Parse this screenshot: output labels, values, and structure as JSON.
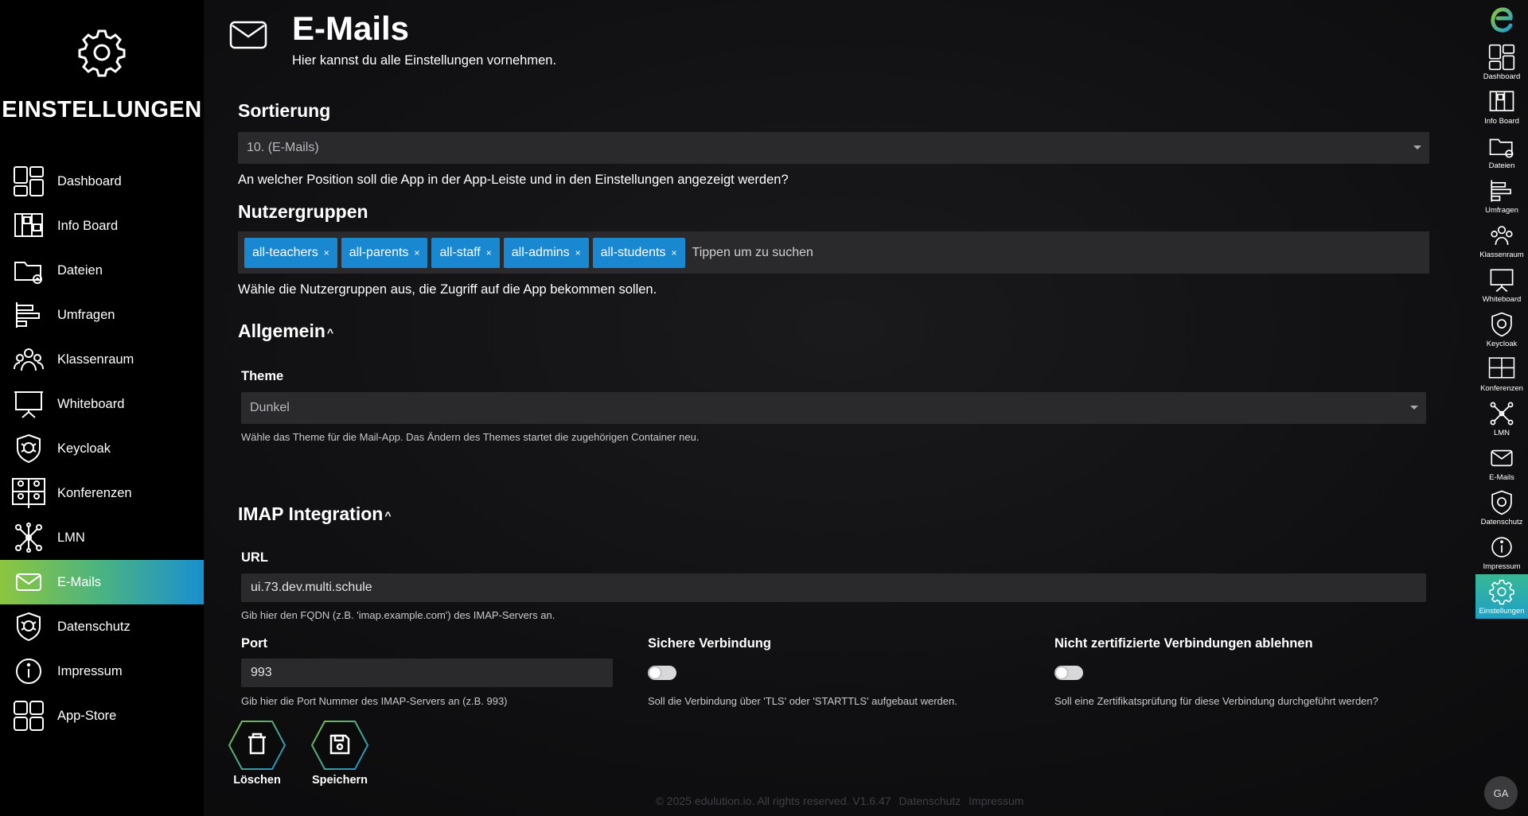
{
  "sidebar": {
    "title": "EINSTELLUNGEN",
    "items": [
      {
        "label": "Dashboard",
        "icon": "dashboard-icon"
      },
      {
        "label": "Info Board",
        "icon": "info-board-icon"
      },
      {
        "label": "Dateien",
        "icon": "files-icon"
      },
      {
        "label": "Umfragen",
        "icon": "surveys-icon"
      },
      {
        "label": "Klassenraum",
        "icon": "classroom-icon"
      },
      {
        "label": "Whiteboard",
        "icon": "whiteboard-icon"
      },
      {
        "label": "Keycloak",
        "icon": "keycloak-icon"
      },
      {
        "label": "Konferenzen",
        "icon": "conferences-icon"
      },
      {
        "label": "LMN",
        "icon": "network-icon"
      },
      {
        "label": "E-Mails",
        "icon": "mail-icon",
        "active": true
      },
      {
        "label": "Datenschutz",
        "icon": "privacy-icon"
      },
      {
        "label": "Impressum",
        "icon": "info-icon"
      },
      {
        "label": "App-Store",
        "icon": "app-store-icon"
      }
    ]
  },
  "rightbar": {
    "logo": "edulution-logo",
    "items": [
      "Dashboard",
      "Info Board",
      "Dateien",
      "Umfragen",
      "Klassenraum",
      "Whiteboard",
      "Keycloak",
      "Konferenzen",
      "LMN",
      "E-Mails",
      "Datenschutz",
      "Impressum",
      "Einstellungen"
    ],
    "avatar": "GA"
  },
  "page": {
    "title": "E-Mails",
    "subtitle": "Hier kannst du alle Einstellungen vornehmen."
  },
  "sorting": {
    "heading": "Sortierung",
    "value": "10. (E-Mails)",
    "help": "An welcher Position soll die App in der App-Leiste und in den Einstellungen angezeigt werden?"
  },
  "groups": {
    "heading": "Nutzergruppen",
    "tags": [
      "all-teachers",
      "all-parents",
      "all-staff",
      "all-admins",
      "all-students"
    ],
    "remove_glyph": "×",
    "placeholder": "Tippen um zu suchen",
    "help": "Wähle die Nutzergruppen aus, die Zugriff auf die App bekommen sollen."
  },
  "general": {
    "heading": "Allgemein",
    "chevron": "^",
    "theme_label": "Theme",
    "theme_value": "Dunkel",
    "theme_help": "Wähle das Theme für die Mail-App. Das Ändern des Themes startet die zugehörigen Container neu."
  },
  "imap": {
    "heading": "IMAP Integration",
    "chevron": "^",
    "url_label": "URL",
    "url_value": "ui.73.dev.multi.schule",
    "url_help": "Gib hier den FQDN (z.B. 'imap.example.com') des IMAP-Servers an.",
    "port_label": "Port",
    "port_value": "993",
    "port_help": "Gib hier die Port Nummer des IMAP-Servers an (z.B. 993)",
    "secure_label": "Sichere Verbindung",
    "secure_help": "Soll die Verbindung über 'TLS' oder 'STARTTLS' aufgebaut werden.",
    "reject_label": "Nicht zertifizierte Verbindungen ablehnen",
    "reject_help": "Soll eine Zertifikatsprüfung für diese Verbindung durchgeführt werden?"
  },
  "actions": {
    "delete_label": "Löschen",
    "save_label": "Speichern"
  },
  "footer": {
    "copyright": "© 2025 edulution.io. All rights reserved. V1.6.47",
    "privacy": "Datenschutz",
    "imprint": "Impressum"
  }
}
